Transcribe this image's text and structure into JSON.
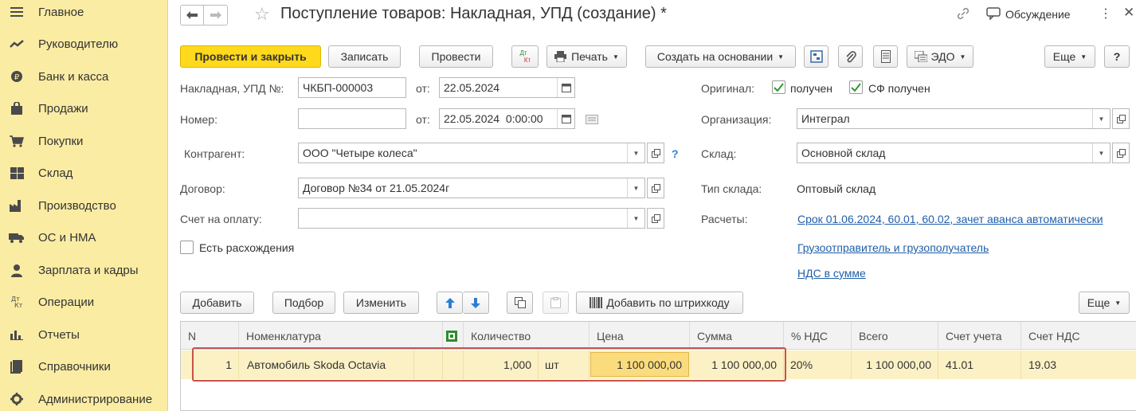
{
  "sidebar": {
    "items": [
      {
        "label": "Главное",
        "icon": "menu-lines-icon"
      },
      {
        "label": "Руководителю",
        "icon": "trend-icon"
      },
      {
        "label": "Банк и касса",
        "icon": "coin-icon"
      },
      {
        "label": "Продажи",
        "icon": "bag-icon"
      },
      {
        "label": "Покупки",
        "icon": "cart-icon"
      },
      {
        "label": "Склад",
        "icon": "warehouse-icon"
      },
      {
        "label": "Производство",
        "icon": "factory-icon"
      },
      {
        "label": "ОС и НМА",
        "icon": "truck-icon"
      },
      {
        "label": "Зарплата и кадры",
        "icon": "person-icon"
      },
      {
        "label": "Операции",
        "icon": "dt-kt-icon"
      },
      {
        "label": "Отчеты",
        "icon": "bar-chart-icon"
      },
      {
        "label": "Справочники",
        "icon": "book-icon"
      },
      {
        "label": "Администрирование",
        "icon": "gear-icon"
      }
    ]
  },
  "header": {
    "title": "Поступление товаров: Накладная, УПД (создание) *",
    "discussion_label": "Обсуждение"
  },
  "toolbar": {
    "post_close": "Провести и закрыть",
    "save": "Записать",
    "post": "Провести",
    "dtkt_top": "Дт",
    "dtkt_bottom": "Кт",
    "print": "Печать",
    "create_based": "Создать на основании",
    "edo": "ЭДО",
    "more": "Еще",
    "help": "?"
  },
  "form": {
    "invoice_label": "Накладная, УПД №:",
    "invoice_value": "ЧКБП-000003",
    "from_label": "от:",
    "invoice_date": "22.05.2024",
    "number_label": "Номер:",
    "number_value": "",
    "from_label2": "от:",
    "number_date": "22.05.2024  0:00:00",
    "counterparty_label": "Контрагент:",
    "counterparty_value": "ООО \"Четыре колеса\"",
    "counterparty_help": "?",
    "contract_label": "Договор:",
    "contract_value": "Договор №34 от 21.05.2024г",
    "payment_label": "Счет на оплату:",
    "payment_value": "",
    "discrepancy_label": "Есть расхождения",
    "original_label": "Оригинал:",
    "received_label": "получен",
    "sf_received_label": "СФ получен",
    "org_label": "Организация:",
    "org_value": "Интеграл",
    "warehouse_label": "Склад:",
    "warehouse_value": "Основной склад",
    "warehouse_type_label": "Тип склада:",
    "warehouse_type_value": "Оптовый склад",
    "settlements_label": "Расчеты:",
    "settlements_link": "Срок 01.06.2024, 60.01, 60.02, зачет аванса автоматически",
    "shipper_link": "Грузоотправитель и грузополучатель",
    "vat_link": "НДС в сумме"
  },
  "table_toolbar": {
    "add": "Добавить",
    "pick": "Подбор",
    "change": "Изменить",
    "barcode": "Добавить по штрихкоду",
    "more": "Еще"
  },
  "table": {
    "headers": [
      "N",
      "Номенклатура",
      "Количество",
      "Цена",
      "Сумма",
      "% НДС",
      "Всего",
      "Счет учета",
      "Счет НДС"
    ],
    "rows": [
      {
        "n": "1",
        "item": "Автомобиль Skoda Octavia",
        "qty": "1,000",
        "unit": "шт",
        "price": "1 100 000,00",
        "sum": "1 100 000,00",
        "vat": "20%",
        "total": "1 100 000,00",
        "account": "41.01",
        "vat_account": "19.03"
      }
    ]
  }
}
